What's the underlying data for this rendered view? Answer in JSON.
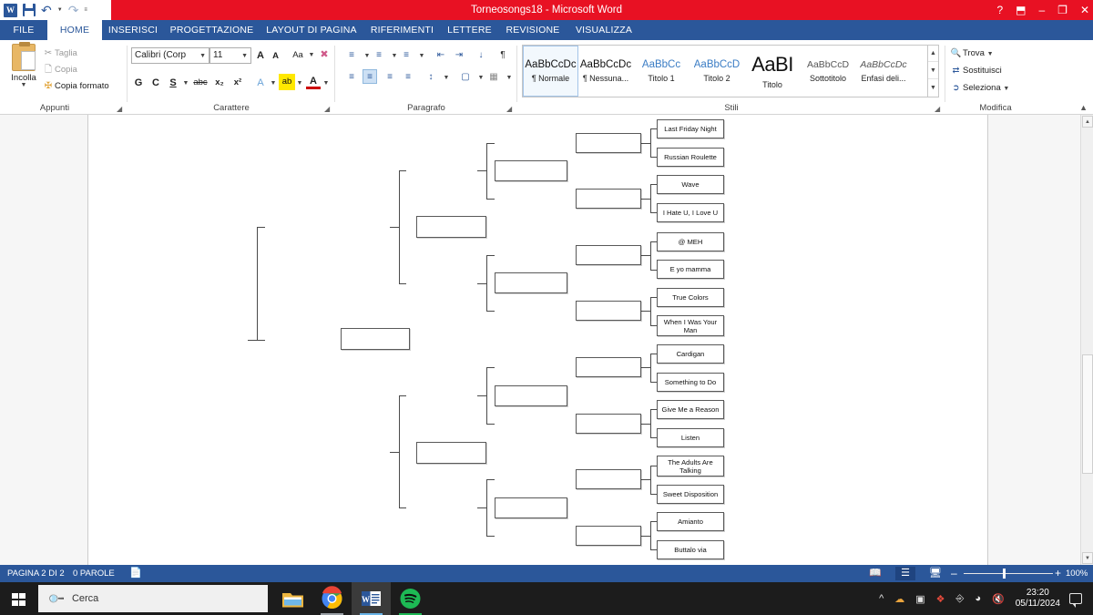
{
  "window": {
    "title": "Torneosongs18 -  Microsoft Word",
    "quick_access": [
      "word-icon",
      "save-icon",
      "undo-icon",
      "redo-icon",
      "customize-qat-icon"
    ],
    "controls": {
      "help": "?",
      "ribbon_display": "⬒",
      "minimize": "–",
      "restore": "❐",
      "close": "✕"
    }
  },
  "ribbon": {
    "tabs": [
      {
        "label": "FILE"
      },
      {
        "label": "HOME"
      },
      {
        "label": "INSERISCI"
      },
      {
        "label": "PROGETTAZIONE"
      },
      {
        "label": "LAYOUT DI PAGINA"
      },
      {
        "label": "RIFERIMENTI"
      },
      {
        "label": "LETTERE"
      },
      {
        "label": "REVISIONE"
      },
      {
        "label": "VISUALIZZA"
      }
    ],
    "active_tab": "HOME",
    "groups": {
      "clipboard": {
        "label": "Appunti",
        "paste": "Incolla",
        "cut": "Taglia",
        "copy": "Copia",
        "format_painter": "Copia formato"
      },
      "font": {
        "label": "Carattere",
        "font_name": "Calibri (Corp",
        "font_size": "11",
        "grow": "A",
        "shrink": "A",
        "change_case": "Aa",
        "clear_formatting": "clear-format-icon",
        "bold": "G",
        "italic": "C",
        "underline": "S",
        "strikethrough": "abc",
        "subscript": "x₂",
        "superscript": "x²",
        "text_effects": "A",
        "highlight": "ab",
        "font_color": "A"
      },
      "paragraph": {
        "label": "Paragrafo"
      },
      "styles": {
        "label": "Stili",
        "items": [
          {
            "preview": "AaBbCcDc",
            "name": "¶ Normale",
            "kind": "normal",
            "selected": true
          },
          {
            "preview": "AaBbCcDc",
            "name": "¶ Nessuna...",
            "kind": "normal",
            "selected": false
          },
          {
            "preview": "AaBbCс",
            "name": "Titolo 1",
            "kind": "blue",
            "selected": false
          },
          {
            "preview": "AaBbCcD",
            "name": "Titolo 2",
            "kind": "blue",
            "selected": false
          },
          {
            "preview": "AaBІ",
            "name": "Titolo",
            "kind": "big",
            "selected": false
          },
          {
            "preview": "AaBbCcD",
            "name": "Sottotitolo",
            "kind": "gray",
            "selected": false
          },
          {
            "preview": "AaBbCcDс",
            "name": "Enfasi deli...",
            "kind": "ital",
            "selected": false
          }
        ]
      },
      "editing": {
        "label": "Modifica",
        "find": "Trova",
        "replace": "Sostituisci",
        "select": "Seleziona"
      }
    }
  },
  "document": {
    "bracket": {
      "title": "tournament-bracket",
      "round_of_16": [
        "Last Friday Night",
        "Russian Roulette",
        "Wave",
        "I Hate U, I Love U",
        "@ MEH",
        "E yo mamma",
        "True Colors",
        "When I Was Your Man",
        "Cardigan",
        "Something to Do",
        "Give Me a Reason",
        "Listen",
        "The Adults Are Talking",
        "Sweet Disposition",
        "Amianto",
        "Buttalo via"
      ],
      "quarterfinals": [
        "",
        "",
        "",
        "",
        "",
        "",
        "",
        ""
      ],
      "semifinals": [
        "",
        "",
        "",
        ""
      ],
      "finals": [
        "",
        ""
      ],
      "winner": ""
    }
  },
  "status_bar": {
    "page": "PAGINA 2 DI 2",
    "words": "0 PAROLE",
    "proofing": "proofing-icon",
    "views": [
      "read-mode-icon",
      "print-layout-icon",
      "web-layout-icon"
    ],
    "active_view": "print-layout-icon",
    "zoom_out": "–",
    "zoom_in": "+",
    "zoom_level": "100%"
  },
  "taskbar": {
    "start": "windows-start-icon",
    "search_placeholder": "Cerca",
    "apps": [
      {
        "name": "file-explorer",
        "active": false
      },
      {
        "name": "google-chrome",
        "active": false
      },
      {
        "name": "microsoft-word",
        "active": true
      },
      {
        "name": "spotify",
        "active": false
      }
    ],
    "tray": [
      "show-hidden-icons",
      "onedrive-icon",
      "webcam-icon",
      "adobe-icon",
      "keyboard-icon",
      "wifi-icon",
      "volume-muted-icon"
    ],
    "clock_time": "23:20",
    "clock_date": "05/11/2024",
    "action_center": "action-center-icon"
  },
  "colors": {
    "title_bar": "#e81123",
    "ribbon_accent": "#2b579a",
    "status_bar": "#2b579a",
    "taskbar": "#1c1c1c"
  }
}
